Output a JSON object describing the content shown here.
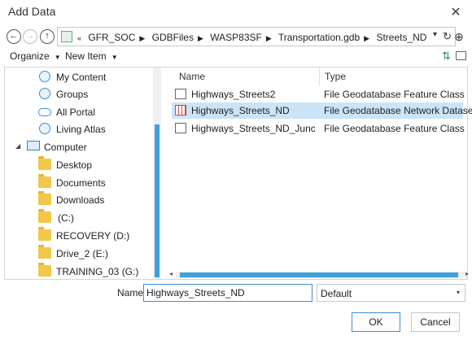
{
  "window": {
    "title": "Add Data",
    "close_glyph": "✕"
  },
  "nav": {
    "back_glyph": "←",
    "forward_glyph": "→",
    "up_glyph": "↑",
    "overflow_glyph": "«",
    "breadcrumbs": [
      "GFR_SOC",
      "GDBFiles",
      "WASP83SF",
      "Transportation.gdb",
      "Streets_ND"
    ],
    "dropdown_glyph": "▾",
    "refresh_glyph": "↻",
    "right_glyph": "⊕"
  },
  "toolbar": {
    "organize": "Organize",
    "new_item": "New Item",
    "caret": "▼",
    "sort_glyph": "⇅"
  },
  "sidebar": {
    "expand_glyph": "◢",
    "items": [
      {
        "label": "My Content",
        "icon": "globe-icon"
      },
      {
        "label": "Groups",
        "icon": "globe-icon"
      },
      {
        "label": "All Portal",
        "icon": "cloud-icon"
      },
      {
        "label": "Living Atlas",
        "icon": "globe-icon"
      },
      {
        "label": "Computer",
        "icon": "computer-icon"
      },
      {
        "label": "Desktop",
        "icon": "folder-icon"
      },
      {
        "label": "Documents",
        "icon": "folder-icon"
      },
      {
        "label": "Downloads",
        "icon": "folder-icon"
      },
      {
        "label": "(C:)",
        "icon": "folder-icon"
      },
      {
        "label": "RECOVERY (D:)",
        "icon": "folder-icon"
      },
      {
        "label": "Drive_2 (E:)",
        "icon": "folder-icon"
      },
      {
        "label": "TRAINING_03 (G:)",
        "icon": "folder-icon"
      }
    ]
  },
  "files": {
    "columns": [
      "Name",
      "Type"
    ],
    "rows": [
      {
        "name": "Highways_Streets2",
        "type": "File Geodatabase Feature Class",
        "icon": "line-feature-class-icon",
        "selected": false
      },
      {
        "name": "Highways_Streets_ND",
        "type": "File Geodatabase Network Dataset",
        "icon": "network-dataset-icon",
        "selected": true
      },
      {
        "name": "Highways_Streets_ND_Junctions",
        "type": "File Geodatabase Feature Class",
        "icon": "point-feature-class-icon",
        "selected": false
      }
    ],
    "scroll_left_glyph": "◂",
    "scroll_right_glyph": "▸"
  },
  "bottom": {
    "name_label": "Name",
    "name_value": "Highways_Streets_ND",
    "filter_value": "Default",
    "filter_caret": "▾",
    "ok_label": "OK",
    "cancel_label": "Cancel"
  },
  "colors": {
    "accent": "#3a8fd8",
    "scroll_thumb": "#3fa0de",
    "selection": "#cce4f7",
    "folder": "#f2c84b"
  }
}
